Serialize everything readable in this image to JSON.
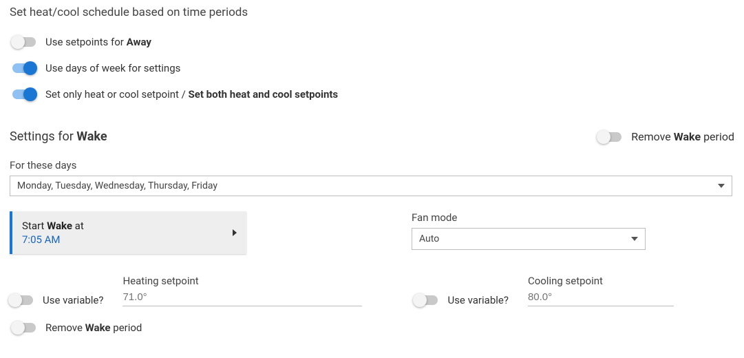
{
  "heading": "Set heat/cool schedule based on time periods",
  "toggles": {
    "away": {
      "on": false,
      "label_prefix": "Use setpoints for ",
      "label_bold": "Away"
    },
    "days": {
      "on": true,
      "label": "Use days of week for settings"
    },
    "both": {
      "on": true,
      "label_plain": "Set only heat or cool setpoint / ",
      "label_bold": "Set both heat and cool setpoints"
    }
  },
  "section": {
    "title_prefix": "Settings for ",
    "title_bold": "Wake",
    "remove_prefix": "Remove ",
    "remove_bold": "Wake",
    "remove_suffix": " period",
    "remove_on": false
  },
  "days": {
    "label": "For these days",
    "value": "Monday, Tuesday, Wednesday, Thursday, Friday"
  },
  "card": {
    "line1_prefix": "Start ",
    "line1_bold": "Wake",
    "line1_suffix": " at",
    "time": "7:05 AM"
  },
  "fan": {
    "label": "Fan mode",
    "value": "Auto"
  },
  "heating": {
    "use_variable_label": "Use variable?",
    "use_variable_on": false,
    "label": "Heating setpoint",
    "value": "71.0°"
  },
  "cooling": {
    "use_variable_label": "Use variable?",
    "use_variable_on": false,
    "label": "Cooling setpoint",
    "value": "80.0°"
  },
  "bottom_remove": {
    "on": false,
    "prefix": "Remove ",
    "bold": "Wake",
    "suffix": " period"
  }
}
